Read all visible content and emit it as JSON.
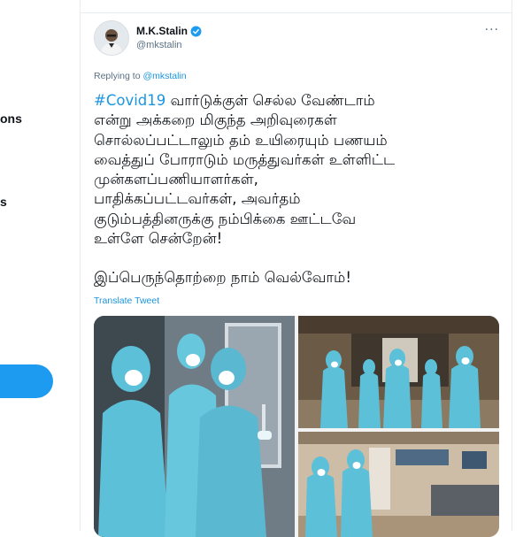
{
  "sidebar": {
    "items": [
      {
        "label": "ons"
      },
      {
        "label": "s"
      }
    ]
  },
  "tweet": {
    "author_name": "M.K.Stalin",
    "author_handle": "@mkstalin",
    "more_label": "···",
    "replying_prefix": "Replying to",
    "replying_to": "@mkstalin",
    "hashtag": "#Covid19",
    "lines": [
      " வார்டுக்குள் செல்ல வேண்டாம்",
      "என்று அக்கறை மிகுந்த அறிவுரைகள்",
      "சொல்லப்பட்டாலும் தம் உயிரையும் பணயம்",
      "வைத்துப் போராடும் மருத்துவர்கள் உள்ளிட்ட",
      "முன்களப்பணியாளர்கள்,",
      "பாதிக்கப்பட்டவர்கள், அவர்தம்",
      "குடும்பத்தினருக்கு நம்பிக்கை ஊட்டவே",
      "உள்ளே சென்றேன்!"
    ],
    "closing_line": "இப்பெருந்தொற்றை நாம் வெல்வோம்!",
    "translate_label": "Translate Tweet"
  },
  "colors": {
    "link": "#1b95e0",
    "button": "#1d9bf0",
    "ppe_suit": "#5bc0d8",
    "text": "#0f1419",
    "muted": "#5b7083"
  }
}
